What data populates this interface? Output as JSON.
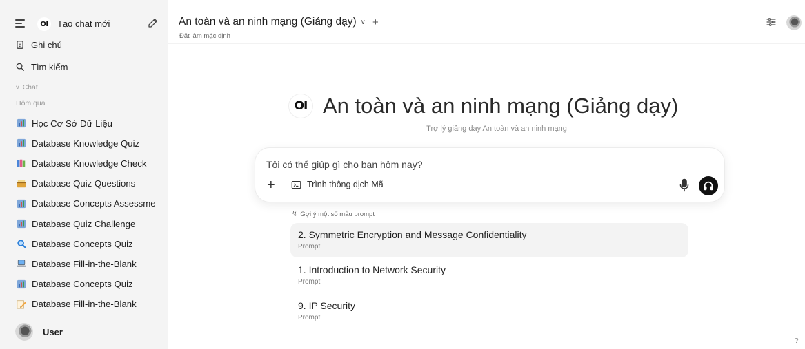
{
  "sidebar": {
    "new_chat_label": "Tạo chat mới",
    "logo_text": "OI",
    "notes_label": "Ghi chú",
    "search_label": "Tìm kiếm",
    "chat_section": "Chat",
    "yesterday_label": "Hôm qua",
    "chats": [
      {
        "label": "Học Cơ Sở Dữ Liệu",
        "icon": "bar-chart-icon"
      },
      {
        "label": "Database Knowledge Quiz",
        "icon": "bar-chart-icon"
      },
      {
        "label": "Database Knowledge Check",
        "icon": "books-icon"
      },
      {
        "label": "Database Quiz Questions",
        "icon": "card-box-icon"
      },
      {
        "label": "Database Concepts Assessme",
        "icon": "bar-chart-icon"
      },
      {
        "label": "Database Quiz Challenge",
        "icon": "bar-chart-icon"
      },
      {
        "label": "Database Concepts Quiz",
        "icon": "magnifier-icon"
      },
      {
        "label": "Database Fill-in-the-Blank",
        "icon": "laptop-icon"
      },
      {
        "label": "Database Concepts Quiz",
        "icon": "bar-chart-icon"
      },
      {
        "label": "Database Fill-in-the-Blank",
        "icon": "pencil-memo-icon"
      }
    ],
    "user_name": "User"
  },
  "header": {
    "model_title": "An toàn và an ninh mạng (Giảng dạy)",
    "set_default": "Đặt làm mặc định"
  },
  "main": {
    "logo_text": "OI",
    "hero_title": "An toàn và an ninh mạng (Giảng dạy)",
    "hero_subtitle": "Trợ lý giảng dạy An toàn và an ninh mạng",
    "composer_placeholder": "Tôi có thể giúp gì cho bạn hôm nay?",
    "code_interpreter_label": "Trình thông dịch Mã",
    "suggest_label": "Gợi ý một số mẫu prompt",
    "prompts": [
      {
        "title": "2. Symmetric Encryption and Message Confidentiality",
        "sub": "Prompt"
      },
      {
        "title": "1. Introduction to Network Security",
        "sub": "Prompt"
      },
      {
        "title": "9. IP Security",
        "sub": "Prompt"
      }
    ],
    "help_label": "?"
  }
}
